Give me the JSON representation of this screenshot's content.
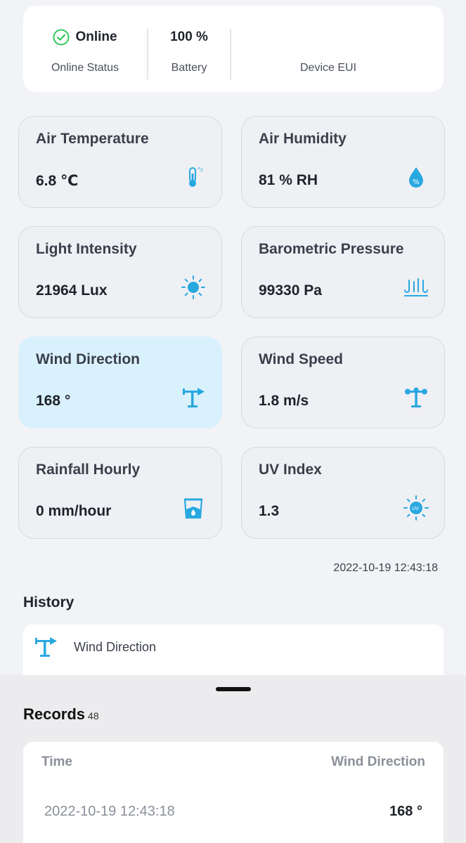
{
  "status": {
    "online_value": "Online",
    "online_label": "Online Status",
    "battery_value": "100 %",
    "battery_label": "Battery",
    "eui_value": "",
    "eui_label": "Device EUI"
  },
  "tiles": [
    {
      "title": "Air Temperature",
      "value": "6.8 ℃",
      "icon": "thermometer-icon"
    },
    {
      "title": "Air Humidity",
      "value": "81 % RH",
      "icon": "humidity-drop-icon"
    },
    {
      "title": "Light Intensity",
      "value": "21964 Lux",
      "icon": "sun-icon"
    },
    {
      "title": "Barometric Pressure",
      "value": "99330 Pa",
      "icon": "pressure-icon"
    },
    {
      "title": "Wind Direction",
      "value": "168 °",
      "icon": "wind-vane-icon"
    },
    {
      "title": "Wind Speed",
      "value": "1.8 m/s",
      "icon": "anemometer-icon"
    },
    {
      "title": "Rainfall Hourly",
      "value": "0 mm/hour",
      "icon": "rain-gauge-icon"
    },
    {
      "title": "UV Index",
      "value": "1.3",
      "icon": "uv-sun-icon"
    }
  ],
  "updated_at": "2022-10-19 12:43:18",
  "history": {
    "title": "History",
    "selected_metric": "Wind Direction"
  },
  "records": {
    "title": "Records",
    "count": "48",
    "columns": [
      "Time",
      "Wind Direction"
    ],
    "rows": [
      {
        "time": "2022-10-19 12:43:18",
        "value": "168 °"
      }
    ]
  },
  "colors": {
    "accent": "#29a8e0",
    "online_green": "#34c759",
    "active_tile": "#d9f1fc"
  }
}
